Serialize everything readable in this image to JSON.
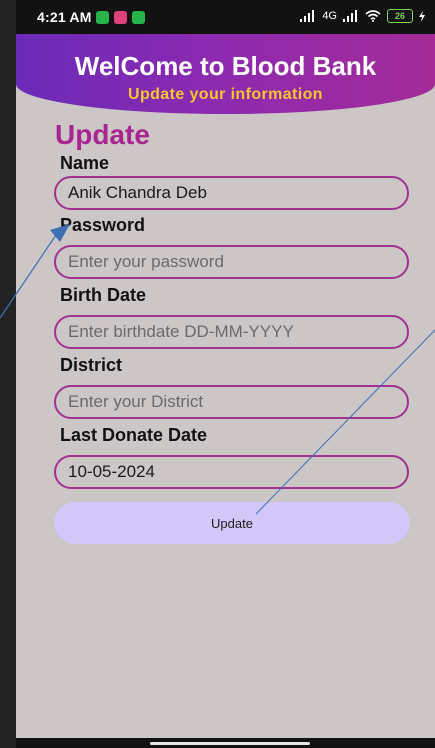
{
  "status_bar": {
    "time": "4:21 AM",
    "network_label": "4G",
    "battery_level": "26",
    "icons": [
      "whatsapp-icon",
      "youtube-icon",
      "whatsapp-icon",
      "signal-icon",
      "signal-icon",
      "wifi-icon",
      "battery-icon",
      "charging-icon"
    ]
  },
  "header": {
    "title": "WelCome to Blood Bank",
    "subtitle": "Update your information"
  },
  "form": {
    "title": "Update",
    "fields": [
      {
        "label": "Name",
        "value": "Anik Chandra Deb",
        "placeholder": ""
      },
      {
        "label": "Password",
        "value": "",
        "placeholder": "Enter your password"
      },
      {
        "label": "Birth Date",
        "value": "",
        "placeholder": "Enter birthdate DD-MM-YYYY"
      },
      {
        "label": "District",
        "value": "",
        "placeholder": "Enter your District"
      },
      {
        "label": "Last Donate Date",
        "value": "10-05-2024",
        "placeholder": ""
      }
    ],
    "submit_label": "Update"
  },
  "colors": {
    "header_gradient": [
      "#6a2bb8",
      "#a42b98"
    ],
    "subtitle": "#f5c630",
    "form_title": "#a8248f",
    "field_border": "#a13290",
    "button_bg": "#d3c7f9",
    "annotation": "#3f6fb5"
  }
}
